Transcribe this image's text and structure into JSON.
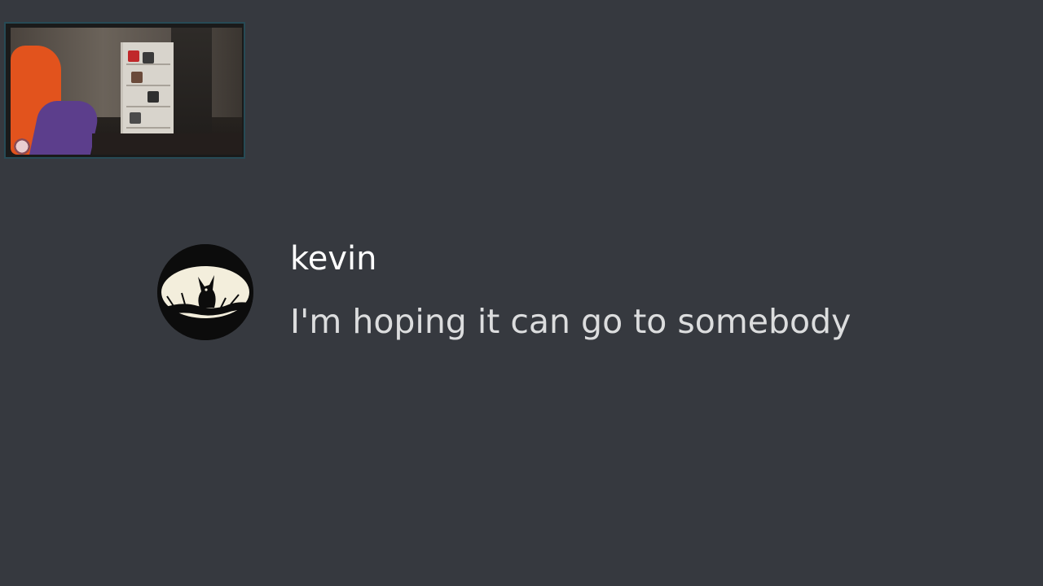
{
  "message": {
    "username": "kevin",
    "text": "I'm hoping it can go to somebody",
    "avatar_icon": "silhouette-fox-avatar-icon"
  },
  "colors": {
    "background": "#36393f",
    "username": "#ffffff",
    "text": "#dcddde",
    "webcam_border": "#274a55"
  }
}
